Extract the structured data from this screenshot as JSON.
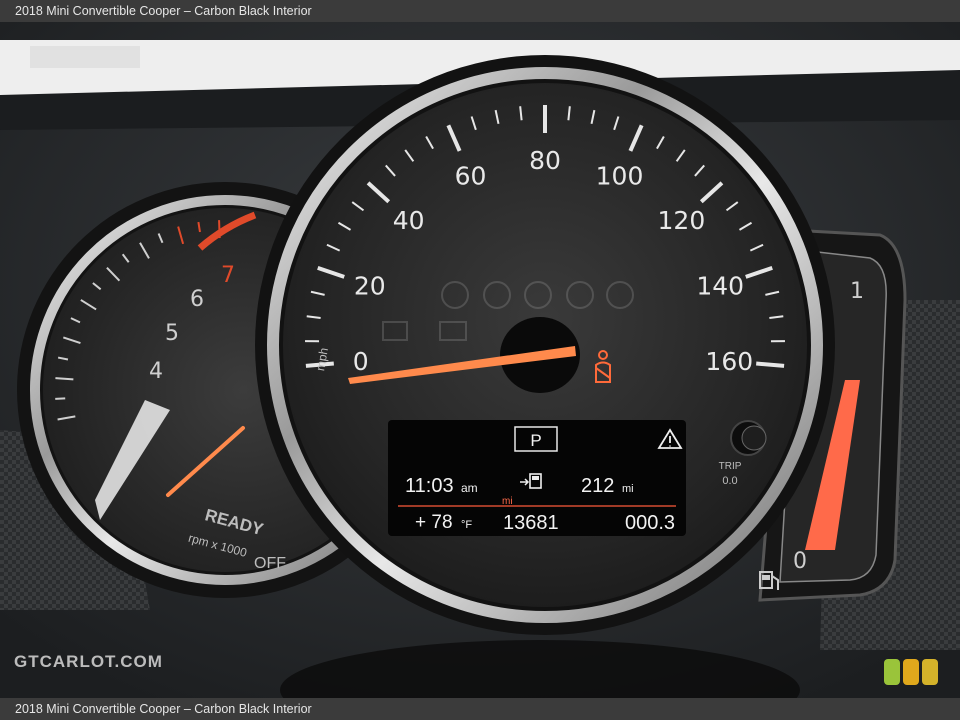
{
  "header": {
    "title": "2018 Mini Convertible Cooper – Carbon Black Interior"
  },
  "footer": {
    "caption": "2018 Mini Convertible Cooper – Carbon Black Interior"
  },
  "watermark": {
    "text": "GTCARLOT.COM"
  },
  "speedometer": {
    "labels": [
      "0",
      "20",
      "40",
      "60",
      "80",
      "100",
      "120",
      "140",
      "160"
    ],
    "unit_label": "mph",
    "speed_mph": 0,
    "trip_label": "TRIP",
    "trip_value": "0.0"
  },
  "tachometer": {
    "labels": [
      "4",
      "5",
      "6",
      "7"
    ],
    "ready_text": "READY",
    "rpm_text": "rpm x 1000",
    "off_text": "OFF"
  },
  "fuel_gauge": {
    "full_label": "1",
    "empty_label": "0"
  },
  "display": {
    "gear": "P",
    "time": "11:03",
    "time_suffix": "am",
    "range": "212",
    "range_unit": "mi",
    "odometer_unit": "mi",
    "temperature": "+ 78",
    "temperature_unit": "°F",
    "odometer": "13681",
    "trip": "000.3"
  },
  "colors": {
    "needle": "#ff8a4c",
    "redline": "#e04a2a",
    "fuel_bar": "#ff6a4a",
    "rating_dot_1": "#9ac43a",
    "rating_dot_2": "#e0a81c",
    "rating_dot_3": "#d4b22a"
  }
}
